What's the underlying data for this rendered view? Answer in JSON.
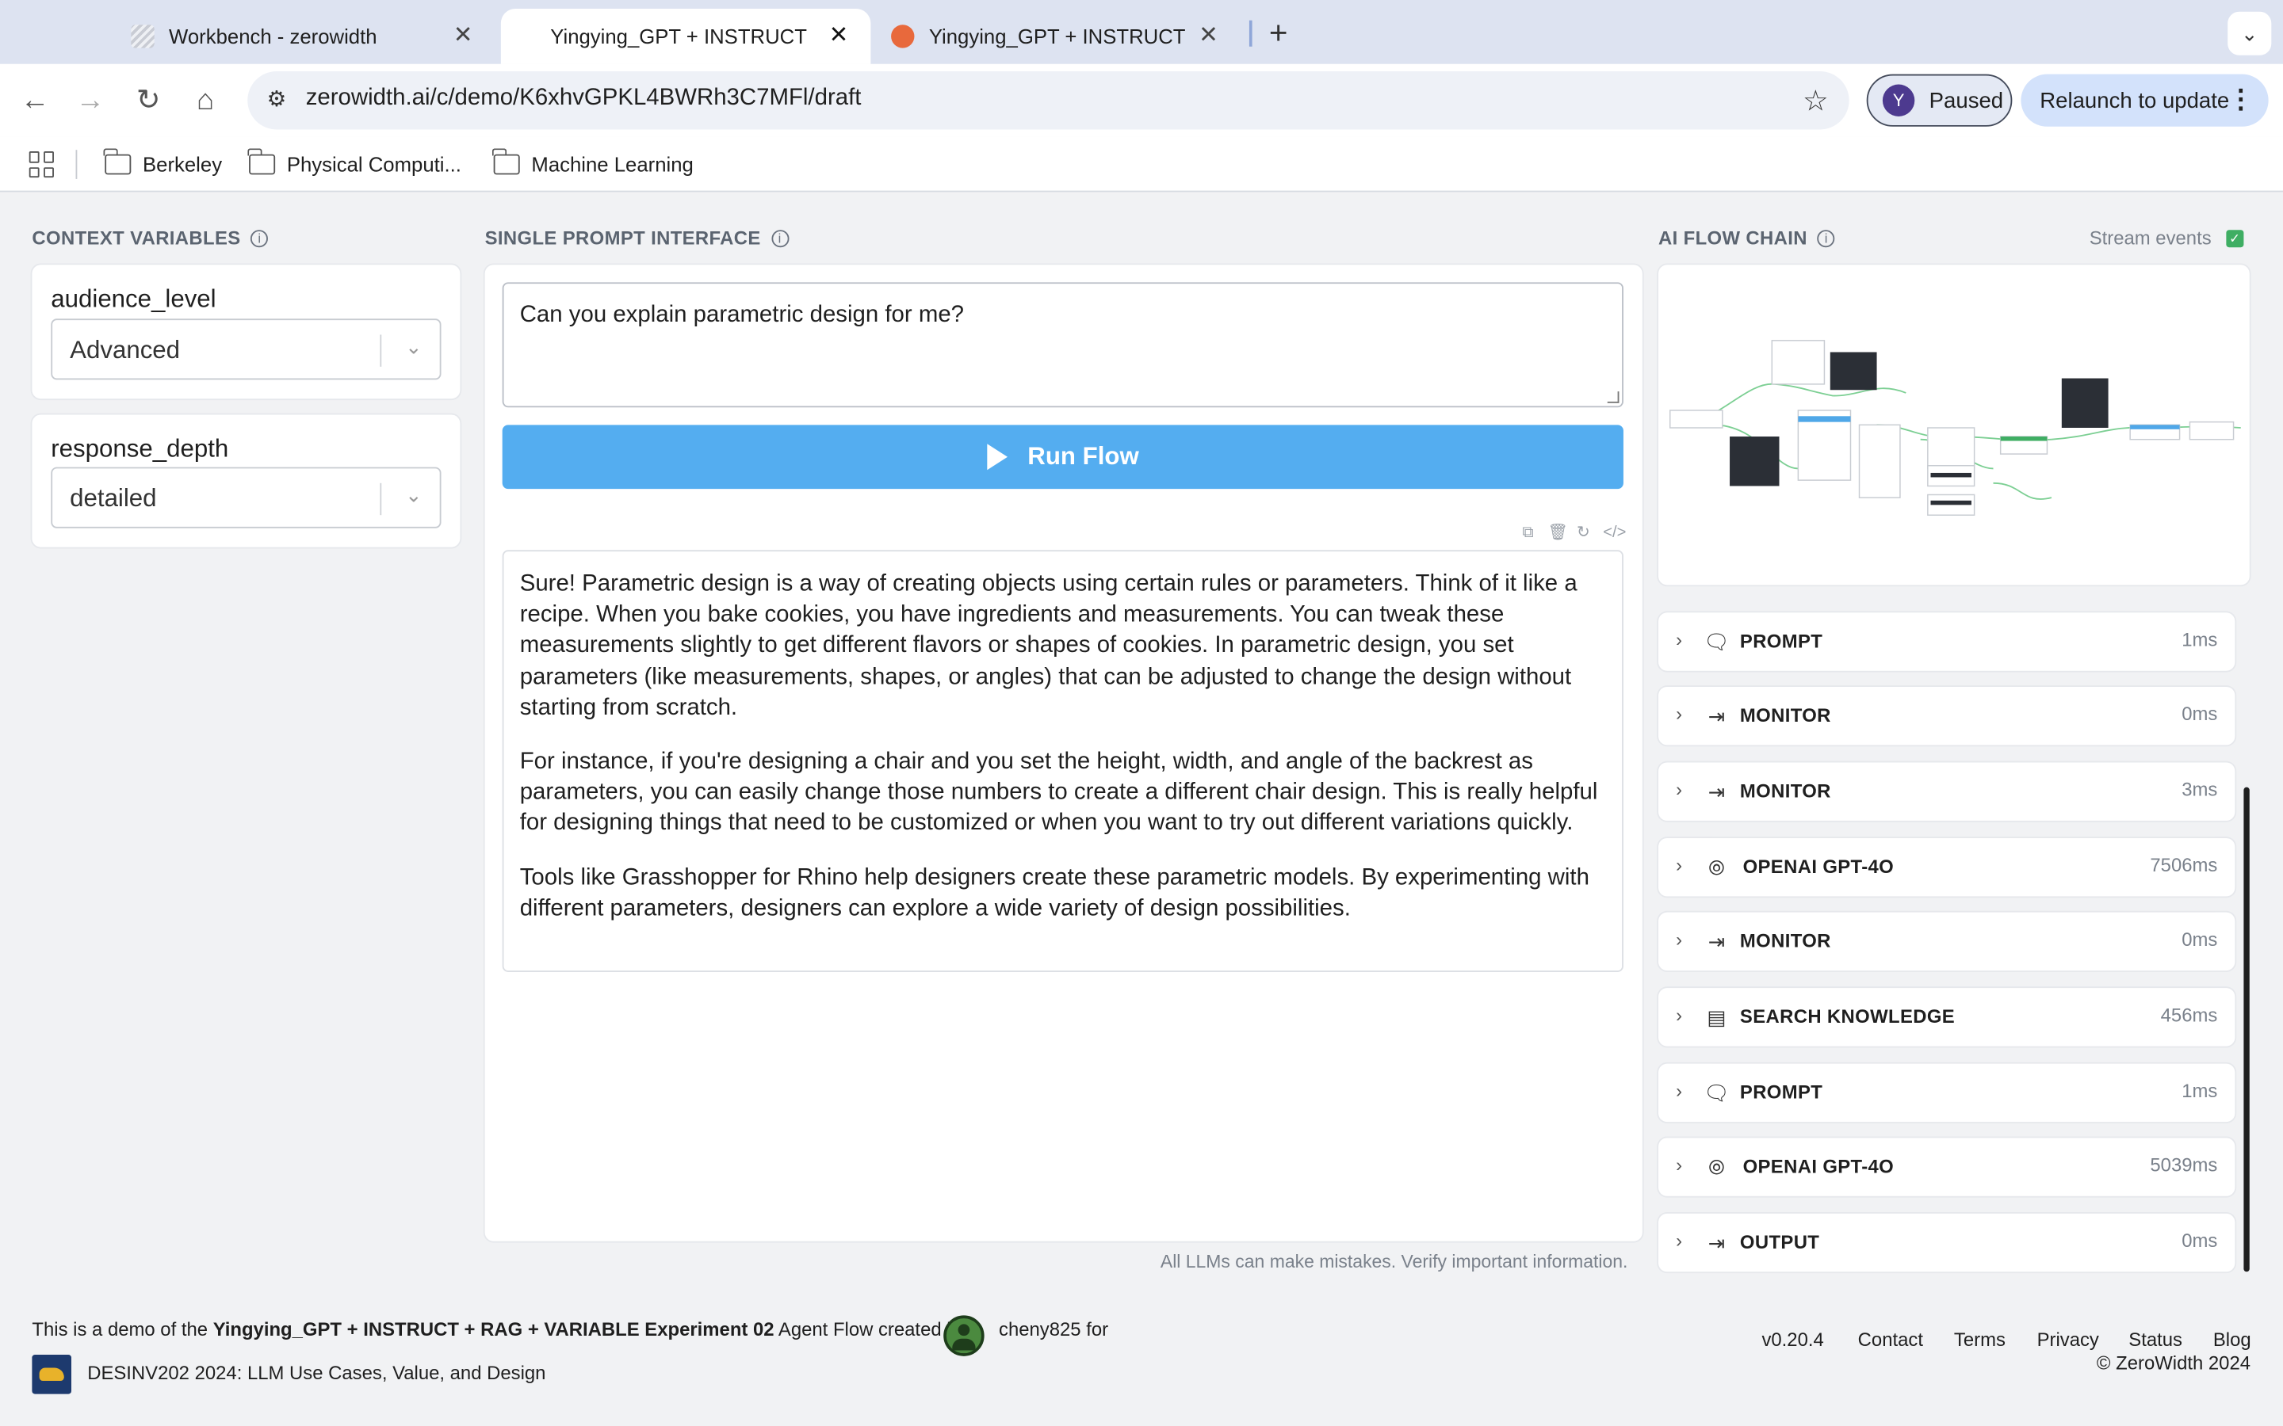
{
  "browser": {
    "tabs": [
      {
        "title": "Workbench - zerowidth",
        "close": "✕"
      },
      {
        "title": "Yingying_GPT + INSTRUCT + RAG + VARIABLE",
        "close": "✕"
      },
      {
        "title": "Yingying_GPT + INSTRUCT + RAG + VARIABLE",
        "close": "✕"
      }
    ],
    "new_tab": "+",
    "url": "zerowidth.ai/c/demo/K6xhvGPKL4BWRh3C7MFl/draft",
    "profile": {
      "initial": "Y",
      "label": "Paused"
    },
    "relaunch": "Relaunch to update",
    "bookmarks": [
      "Berkeley",
      "Physical Computi...",
      "Machine Learning"
    ]
  },
  "context": {
    "heading": "CONTEXT VARIABLES",
    "vars": [
      {
        "name": "audience_level",
        "value": "Advanced"
      },
      {
        "name": "response_depth",
        "value": "detailed"
      }
    ]
  },
  "prompt": {
    "heading": "SINGLE PROMPT INTERFACE",
    "input": "Can you explain parametric design for me?",
    "run_label": "Run Flow",
    "answer": [
      "Sure! Parametric design is a way of creating objects using certain rules or parameters. Think of it like a recipe. When you bake cookies, you have ingredients and measurements. You can tweak these measurements slightly to get different flavors or shapes of cookies. In parametric design, you set parameters (like measurements, shapes, or angles) that can be adjusted to change the design without starting from scratch.",
      "For instance, if you're designing a chair and you set the height, width, and angle of the backrest as parameters, you can easily change those numbers to create a different chair design. This is really helpful for designing things that need to be customized or when you want to try out different variations quickly.",
      "Tools like Grasshopper for Rhino help designers create these parametric models. By experimenting with different parameters, designers can explore a wide variety of design possibilities."
    ],
    "disclaimer": "All LLMs can make mistakes. Verify important information."
  },
  "flow": {
    "heading": "AI FLOW CHAIN",
    "stream_label": "Stream events",
    "steps": [
      {
        "name": "PROMPT",
        "time": "1ms",
        "icon": "chat-icon"
      },
      {
        "name": "MONITOR",
        "time": "0ms",
        "icon": "arrow-to-bar-icon"
      },
      {
        "name": "MONITOR",
        "time": "3ms",
        "icon": "arrow-to-bar-icon"
      },
      {
        "name": "OPENAI GPT-4O",
        "time": "7506ms",
        "icon": "openai-icon"
      },
      {
        "name": "MONITOR",
        "time": "0ms",
        "icon": "arrow-to-bar-icon"
      },
      {
        "name": "SEARCH KNOWLEDGE",
        "time": "456ms",
        "icon": "knowledge-icon"
      },
      {
        "name": "PROMPT",
        "time": "1ms",
        "icon": "chat-icon"
      },
      {
        "name": "OPENAI GPT-4O",
        "time": "5039ms",
        "icon": "openai-icon"
      },
      {
        "name": "OUTPUT",
        "time": "0ms",
        "icon": "arrow-to-bar-icon"
      }
    ]
  },
  "footer": {
    "line1_pre": "This is a demo of the",
    "flow_name": "Yingying_GPT + INSTRUCT + RAG + VARIABLE Experiment 02",
    "line1_mid": "Agent Flow created by",
    "author": "cheny825 for",
    "course": "DESINV202 2024: LLM Use Cases, Value, and Design",
    "version": "v0.20.4",
    "links": [
      "Contact",
      "Terms",
      "Privacy",
      "Status",
      "Blog"
    ],
    "copyright": "© ZeroWidth 2024"
  },
  "colors": {
    "run_button": "#54adf0",
    "accent_green": "#3fae63"
  }
}
